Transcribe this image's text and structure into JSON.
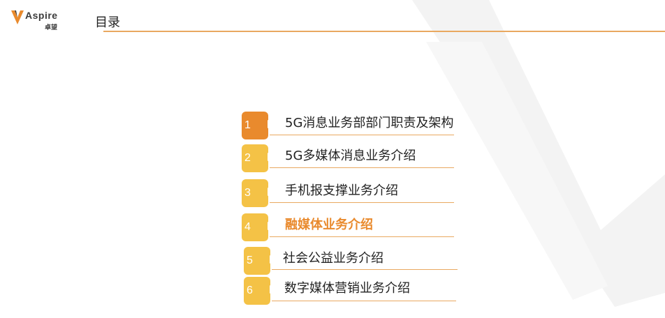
{
  "header": {
    "logo_text": "Aspire",
    "logo_sub": "卓望",
    "title": "目录"
  },
  "colors": {
    "accent_orange": "#e98a2d",
    "badge_yellow": "#f4c246",
    "rule": "#e9a860"
  },
  "toc": {
    "items": [
      {
        "num": "1",
        "label": "5G消息业务部部门职责及架构",
        "active": false
      },
      {
        "num": "2",
        "label": "5G多媒体消息业务介绍",
        "active": false
      },
      {
        "num": "3",
        "label": "手机报支撑业务介绍",
        "active": false
      },
      {
        "num": "4",
        "label": "融媒体业务介绍",
        "active": true
      },
      {
        "num": "5",
        "label": "社会公益业务介绍",
        "active": false
      },
      {
        "num": "6",
        "label": "数字媒体营销业务介绍",
        "active": false
      }
    ]
  }
}
